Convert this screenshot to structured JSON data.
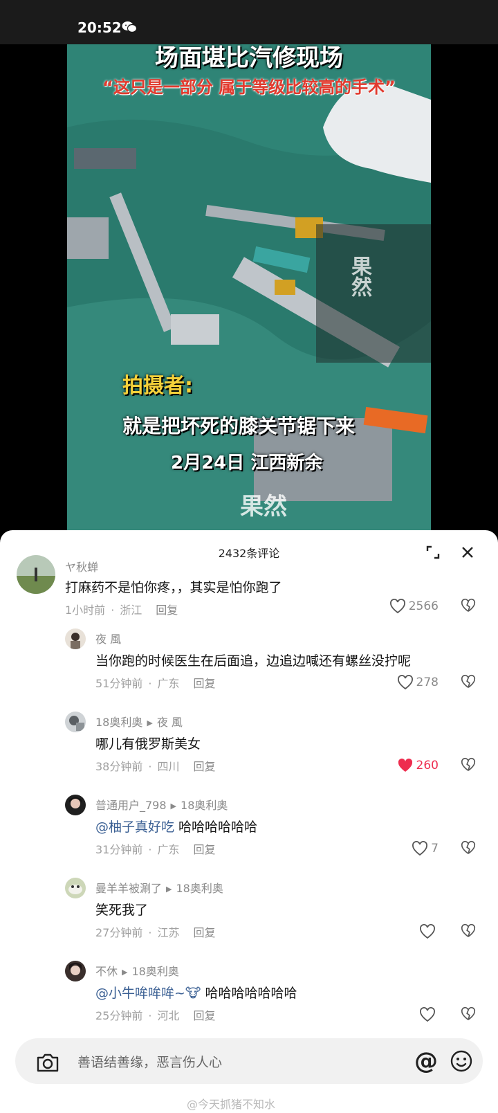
{
  "status_bar": {
    "time": "20:52"
  },
  "video": {
    "title_line1": "场面堪比汽修现场",
    "title_line2": "“这只是一部分 属于等级比较高的手术”",
    "caption_name": "拍摄者:",
    "caption_quote": "就是把坏死的膝关节锯下来",
    "caption_date": "2月24日 江西新余",
    "watermark": "果然"
  },
  "comments_panel": {
    "title": "2432条评论",
    "comments": [
      {
        "user": "ヤ秋蝉",
        "text": "打麻药不是怕你疼，，其实是怕你跑了",
        "time": "1小时前",
        "region": "浙江",
        "reply": "回复",
        "likes": "2566",
        "liked": false
      },
      {
        "user": "夜  風",
        "text": "当你跑的时候医生在后面追，边追边喊还有螺丝没拧呢",
        "time": "51分钟前",
        "region": "广东",
        "reply": "回复",
        "likes": "278",
        "liked": false
      },
      {
        "user": "18奥利奥",
        "reply_to": "夜  風",
        "text": "哪儿有俄罗斯美女",
        "time": "38分钟前",
        "region": "四川",
        "reply": "回复",
        "likes": "260",
        "liked": true
      },
      {
        "user": "普通用户_798",
        "reply_to": "18奥利奥",
        "mention": "@柚子真好吃",
        "text": " 哈哈哈哈哈哈",
        "time": "31分钟前",
        "region": "广东",
        "reply": "回复",
        "likes": "7",
        "liked": false
      },
      {
        "user": "曼羊羊被涮了",
        "reply_to": "18奥利奥",
        "text": "笑死我了",
        "time": "27分钟前",
        "region": "江苏",
        "reply": "回复",
        "likes": "",
        "liked": false
      },
      {
        "user": "不休",
        "reply_to": "18奥利奥",
        "mention": "@小牛哞哞哞~🐮",
        "text": " 哈哈哈哈哈哈哈",
        "time": "25分钟前",
        "region": "河北",
        "reply": "回复",
        "likes": "",
        "liked": false
      }
    ]
  },
  "input_bar": {
    "placeholder": "善语结善缘，恶言伤人心",
    "at_symbol": "@",
    "watermark": "@今天抓猪不知水"
  },
  "colors": {
    "like_active": "#ee2d4f",
    "mention": "#3a5f93",
    "video_bg": "#2f8476"
  }
}
